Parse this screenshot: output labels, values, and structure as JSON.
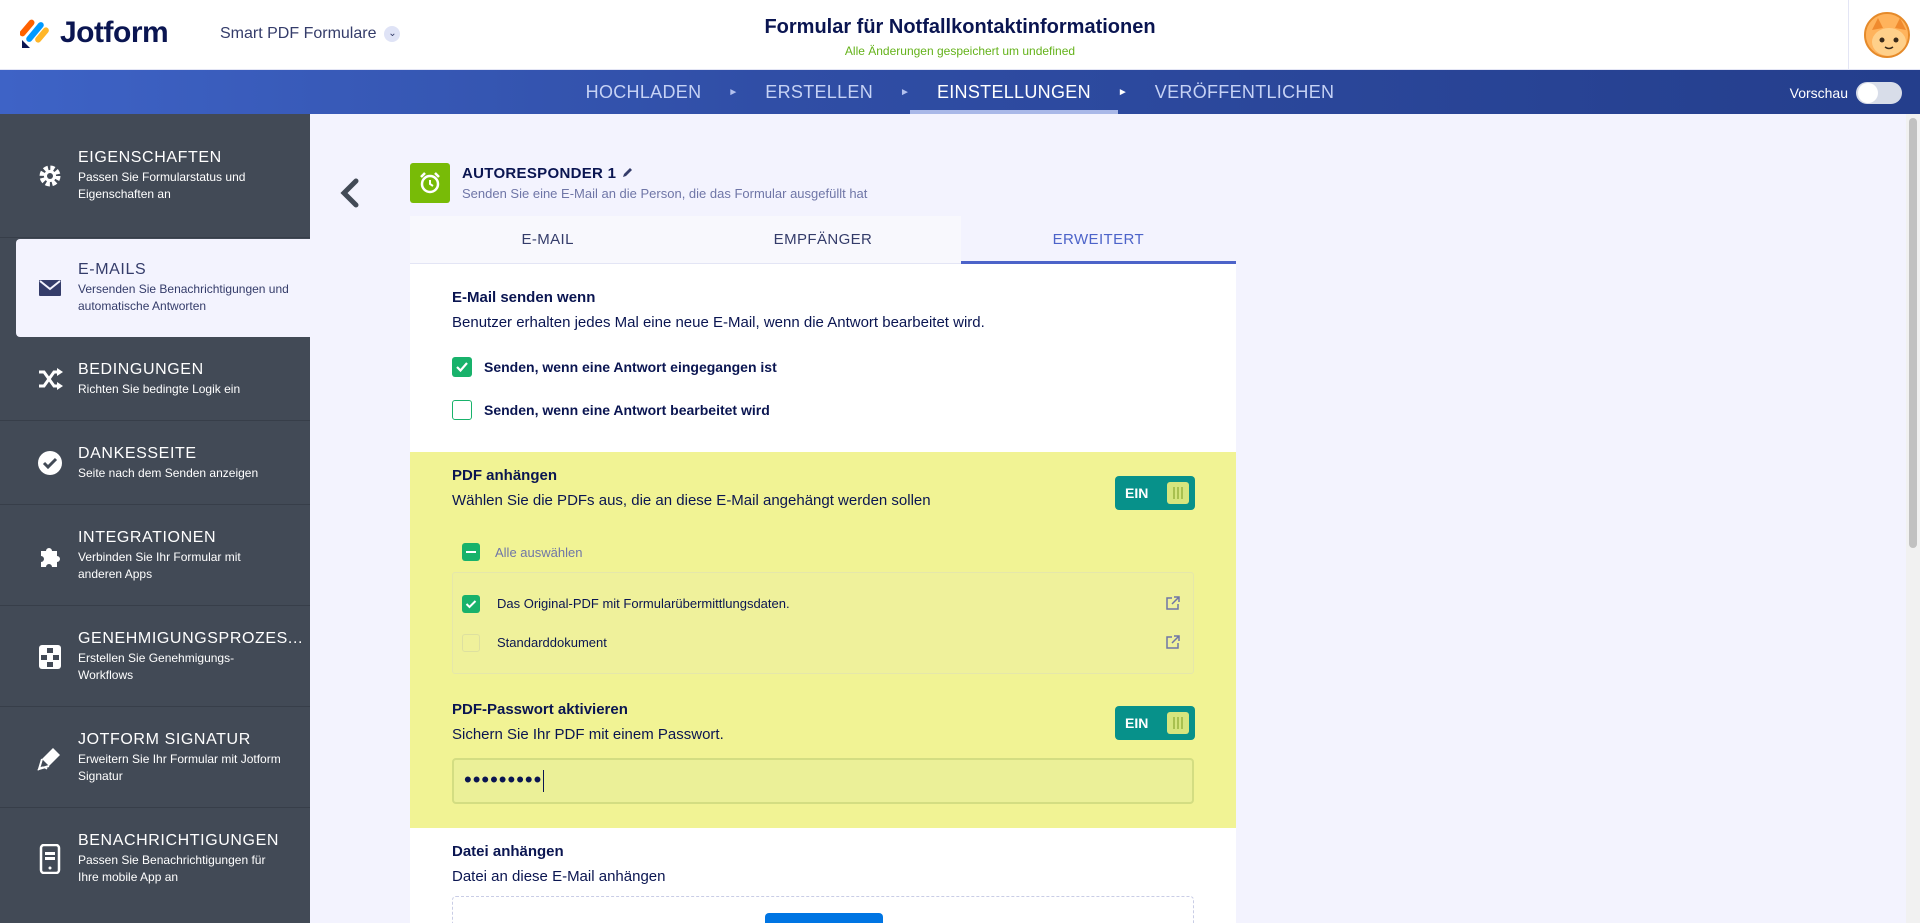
{
  "header": {
    "brand": "Jotform",
    "product": "Smart PDF Formulare",
    "title": "Formular für Notfallkontaktinformationen",
    "subtitle": "Alle Änderungen gespeichert um undefined"
  },
  "nav": {
    "steps": [
      "HOCHLADEN",
      "ERSTELLEN",
      "EINSTELLUNGEN",
      "VERÖFFENTLICHEN"
    ],
    "active_step": "EINSTELLUNGEN",
    "preview_label": "Vorschau"
  },
  "sidebar": {
    "items": [
      {
        "label": "EIGENSCHAFTEN",
        "desc": "Passen Sie Formularstatus und Eigenschaften an",
        "icon": "gear-icon"
      },
      {
        "label": "E-MAILS",
        "desc": "Versenden Sie Benachrichtigungen und automatische Antworten",
        "icon": "envelope-icon"
      },
      {
        "label": "BEDINGUNGEN",
        "desc": "Richten Sie bedingte Logik ein",
        "icon": "shuffle-icon"
      },
      {
        "label": "DANKESSEITE",
        "desc": "Seite nach dem Senden anzeigen",
        "icon": "check-circle-icon"
      },
      {
        "label": "INTEGRATIONEN",
        "desc": "Verbinden Sie Ihr Formular mit anderen Apps",
        "icon": "puzzle-icon"
      },
      {
        "label": "GENEHMIGUNGSPROZES...",
        "desc": "Erstellen Sie Genehmigungs-Workflows",
        "icon": "workflow-icon"
      },
      {
        "label": "JOTFORM SIGNATUR",
        "desc": "Erweitern Sie Ihr Formular mit Jotform Signatur",
        "icon": "pen-icon"
      },
      {
        "label": "BENACHRICHTIGUNGEN",
        "desc": "Passen Sie Benachrichtigungen für Ihre mobile App an",
        "icon": "mobile-icon"
      }
    ],
    "active": "E-MAILS"
  },
  "autoresponder": {
    "title": "AUTORESPONDER 1",
    "subtitle": "Senden Sie eine E-Mail an die Person, die das Formular ausgefüllt hat"
  },
  "tabs": [
    "E-MAIL",
    "EMPFÄNGER",
    "ERWEITERT"
  ],
  "active_tab": "ERWEITERT",
  "send_when": {
    "title": "E-Mail senden wenn",
    "desc": "Benutzer erhalten jedes Mal eine neue E-Mail, wenn die Antwort bearbeitet wird.",
    "options": [
      {
        "label": "Senden, wenn eine Antwort eingegangen ist",
        "checked": true
      },
      {
        "label": "Senden, wenn eine Antwort bearbeitet wird",
        "checked": false
      }
    ]
  },
  "attach_pdf": {
    "title": "PDF anhängen",
    "desc": "Wählen Sie die PDFs aus, die an diese E-Mail angehängt werden sollen",
    "toggle": "EIN",
    "select_all": "Alle auswählen",
    "files": [
      {
        "label": "Das Original-PDF mit Formularübermittlungsdaten.",
        "checked": true
      },
      {
        "label": "Standarddokument",
        "checked": false
      }
    ]
  },
  "pdf_password": {
    "title": "PDF-Passwort aktivieren",
    "desc": "Sichern Sie Ihr PDF mit einem Passwort.",
    "toggle": "EIN",
    "value": "•••••••••"
  },
  "attach_file": {
    "title": "Datei anhängen",
    "desc": "Datei an diese E-Mail anhängen"
  },
  "colors": {
    "accent": "#4c63c9",
    "highlight": "#f1f394",
    "toggle_on": "#07918a",
    "check": "#18b26b",
    "sidebar": "#424a56"
  }
}
